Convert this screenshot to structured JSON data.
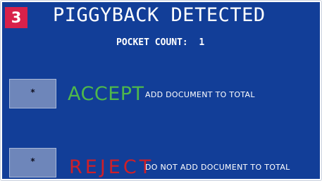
{
  "colors": {
    "panel_bg": "#123e98",
    "badge_bg": "#d8214a",
    "accept": "#4fb84b",
    "reject": "#cf1f28",
    "button_bg": "#6e86ba",
    "text": "#ffffff"
  },
  "header": {
    "step_number": "3",
    "title": "PIGGYBACK DETECTED"
  },
  "pocket": {
    "label": "POCKET COUNT:",
    "value": "1"
  },
  "accept": {
    "button_label": "*",
    "word": "ACCEPT",
    "description": "ADD DOCUMENT TO TOTAL"
  },
  "reject": {
    "button_label": "*",
    "word": "REJECT",
    "description": "DO NOT ADD DOCUMENT TO TOTAL"
  }
}
